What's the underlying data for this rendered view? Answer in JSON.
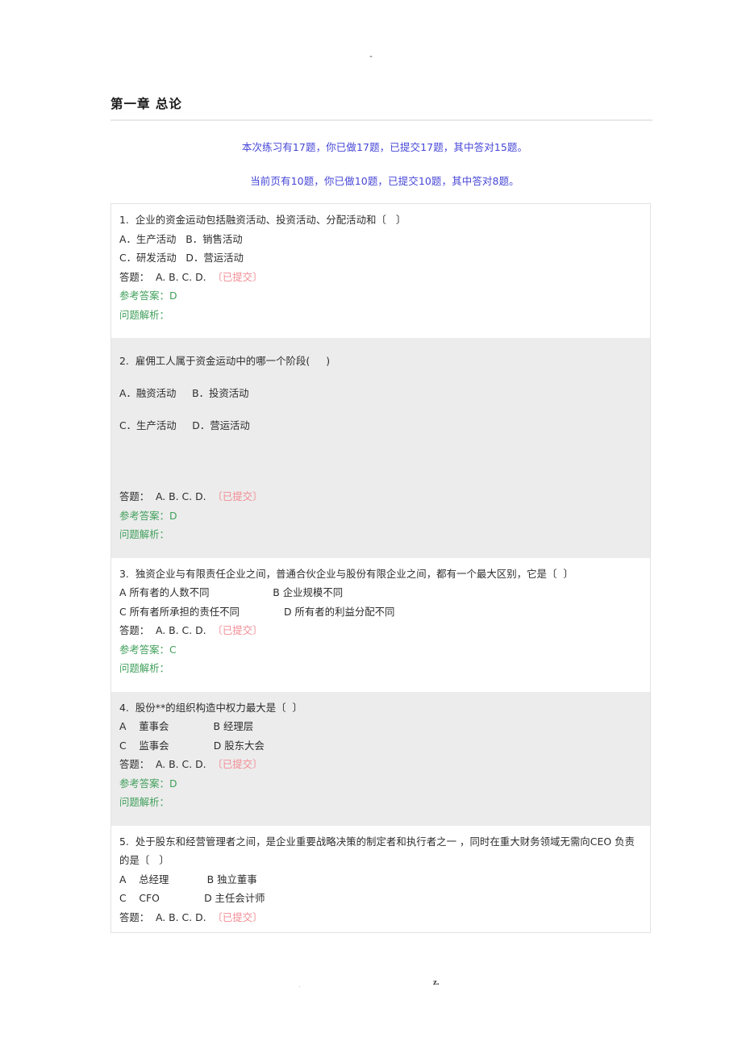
{
  "page": {
    "top_mark": "-",
    "footer_left_mark": ".",
    "footer_right_mark": "z.",
    "colors": {
      "summary_text": "#4646d8",
      "submitted_tag": "#f28b94",
      "reference_answer": "#42a05c",
      "shaded_row_bg": "#ececec",
      "box_border": "#e2e2e2"
    }
  },
  "header": {
    "chapter_title": "第一章 总论"
  },
  "summary": {
    "overall": "本次练习有17题，你已做17题，已提交17题，其中答对15题。",
    "current_page": "当前页有10题，你已做10题，已提交10题，其中答对8题。",
    "overall_values": {
      "total": 17,
      "done": 17,
      "submitted": 17,
      "correct": 15
    },
    "current_page_values": {
      "total": 10,
      "done": 10,
      "submitted": 10,
      "correct": 8
    }
  },
  "labels": {
    "answer_prefix": "答题：",
    "choices_inline": "A. B. C. D.",
    "submitted_tag": "〔已提交〕",
    "reference_prefix": "参考答案：",
    "analysis_prefix": "问题解析："
  },
  "questions": [
    {
      "number": "1.",
      "stem": "企业的资金运动包括融资活动、投资活动、分配活动和〔   〕",
      "option_lines": [
        "A．生产活动   B．销售活动",
        "C．研发活动   D．营运活动"
      ],
      "answer_line": "答题：  A. B. C. D.",
      "submitted": "〔已提交〕",
      "reference": "参考答案：D",
      "analysis": "问题解析：",
      "shaded": false,
      "spaced": false
    },
    {
      "number": "2.",
      "stem": "雇佣工人属于资金运动中的哪一个阶段(     )",
      "option_lines": [
        "A．融资活动     B．投资活动",
        "C．生产活动     D．营运活动"
      ],
      "answer_line": "答题：  A. B. C. D.",
      "submitted": "〔已提交〕",
      "reference": "参考答案：D",
      "analysis": "问题解析：",
      "shaded": true,
      "spaced": true
    },
    {
      "number": "3.",
      "stem": "独资企业与有限责任企业之间，普通合伙企业与股份有限企业之间，都有一个最大区别，它是〔  〕",
      "option_lines": [
        "A 所有者的人数不同                    B 企业规模不同",
        "C 所有者所承担的责任不同              D 所有者的利益分配不同"
      ],
      "answer_line": "答题：  A. B. C. D.",
      "submitted": "〔已提交〕",
      "reference": "参考答案：C",
      "analysis": "问题解析：",
      "shaded": false,
      "spaced": false
    },
    {
      "number": "4.",
      "stem": "股份**的组织构造中权力最大是〔  〕",
      "option_lines": [
        "A    董事会              B 经理层",
        "C    监事会              D 股东大会"
      ],
      "answer_line": "答题：  A. B. C. D.",
      "submitted": "〔已提交〕",
      "reference": "参考答案：D",
      "analysis": "问题解析：",
      "shaded": true,
      "spaced": false
    },
    {
      "number": "5.",
      "stem": "处于股东和经营管理者之间，是企业重要战略决策的制定者和执行者之一 ，同时在重大财务领域无需向CEO 负责的是〔   〕",
      "option_lines": [
        "A    总经理            B 独立董事",
        "C    CFO              D 主任会计师"
      ],
      "answer_line": "答题：  A. B. C. D.",
      "submitted": "〔已提交〕",
      "reference": "",
      "analysis": "",
      "shaded": false,
      "spaced": false
    }
  ]
}
